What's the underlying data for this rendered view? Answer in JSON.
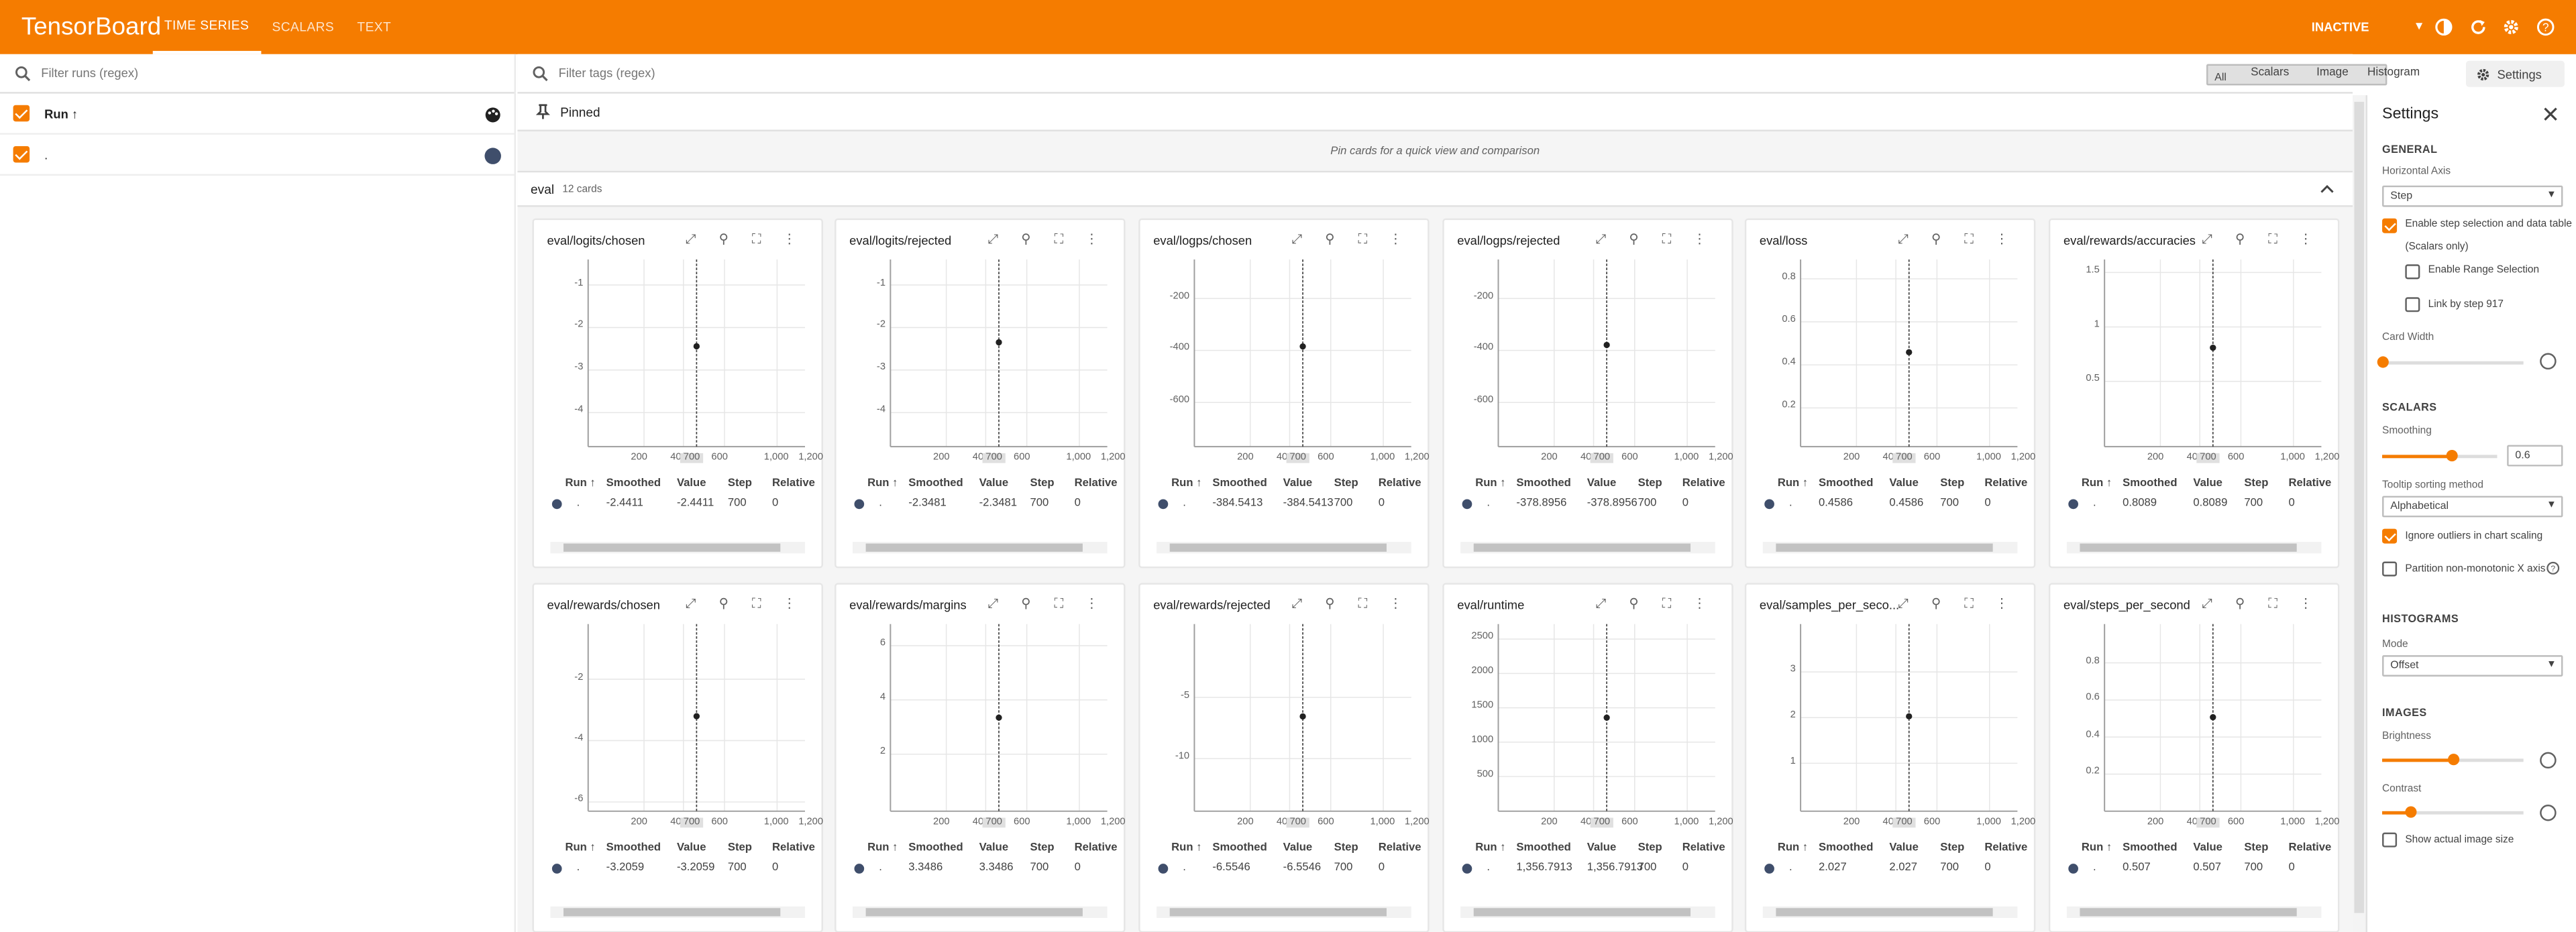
{
  "app": {
    "title": "TensorBoard",
    "tabs": [
      "TIME SERIES",
      "SCALARS",
      "TEXT"
    ],
    "status": "INACTIVE",
    "accent": "#f57c00"
  },
  "runs": {
    "filter_placeholder": "Filter runs (regex)",
    "header": "Run ↑",
    "items": [
      {
        "name": ".",
        "color": "#3f4e6b",
        "checked": true
      }
    ]
  },
  "toolbar": {
    "filter_placeholder": "Filter tags (regex)",
    "chips": [
      "All",
      "Scalars",
      "Image",
      "Histogram"
    ],
    "selected_chip": "All",
    "settings_label": "Settings"
  },
  "pinned": {
    "title": "Pinned",
    "message": "Pin cards for a quick view and comparison"
  },
  "group": {
    "name": "eval",
    "count": "12 cards"
  },
  "table_headers": [
    "Run ↑",
    "Smoothed",
    "Value",
    "Step",
    "Relative"
  ],
  "x_axis": {
    "ticks": [
      "200",
      "400",
      "600",
      "1,000",
      "1,200"
    ],
    "step_marker": "700"
  },
  "cards": [
    {
      "title": "eval/logits/chosen",
      "yticks": [
        "-1",
        "-2",
        "-3",
        "-4"
      ],
      "ylim": [
        -4.8,
        -0.4
      ],
      "value": -2.4411,
      "run": ".",
      "smoothed": "-2.4411",
      "value_text": "-2.4411",
      "step": "700",
      "relative": "0"
    },
    {
      "title": "eval/logits/rejected",
      "yticks": [
        "-1",
        "-2",
        "-3",
        "-4"
      ],
      "ylim": [
        -4.8,
        -0.4
      ],
      "value": -2.3481,
      "run": ".",
      "smoothed": "-2.3481",
      "value_text": "-2.3481",
      "step": "700",
      "relative": "0"
    },
    {
      "title": "eval/logps/chosen",
      "yticks": [
        "-200",
        "-400",
        "-600"
      ],
      "ylim": [
        -770,
        -50
      ],
      "value": -384.5413,
      "run": ".",
      "smoothed": "-384.5413",
      "value_text": "-384.5413",
      "step": "700",
      "relative": "0"
    },
    {
      "title": "eval/logps/rejected",
      "yticks": [
        "-200",
        "-400",
        "-600"
      ],
      "ylim": [
        -770,
        -50
      ],
      "value": -378.8956,
      "run": ".",
      "smoothed": "-378.8956",
      "value_text": "-378.8956",
      "step": "700",
      "relative": "0"
    },
    {
      "title": "eval/loss",
      "yticks": [
        "0.8",
        "0.6",
        "0.4",
        "0.2"
      ],
      "ylim": [
        0.02,
        0.89
      ],
      "value": 0.4586,
      "run": ".",
      "smoothed": "0.4586",
      "value_text": "0.4586",
      "step": "700",
      "relative": "0"
    },
    {
      "title": "eval/rewards/accuracies",
      "yticks": [
        "1.5",
        "1",
        "0.5"
      ],
      "ylim": [
        -0.1,
        1.62
      ],
      "value": 0.8089,
      "run": ".",
      "smoothed": "0.8089",
      "value_text": "0.8089",
      "step": "700",
      "relative": "0"
    },
    {
      "title": "eval/rewards/chosen",
      "yticks": [
        "-2",
        "-4",
        "-6"
      ],
      "ylim": [
        -6.3,
        -0.2
      ],
      "value": -3.2059,
      "run": ".",
      "smoothed": "-3.2059",
      "value_text": "-3.2059",
      "step": "700",
      "relative": "0"
    },
    {
      "title": "eval/rewards/margins",
      "yticks": [
        "6",
        "4",
        "2"
      ],
      "ylim": [
        -0.1,
        6.8
      ],
      "value": 3.3486,
      "run": ".",
      "smoothed": "3.3486",
      "value_text": "3.3486",
      "step": "700",
      "relative": "0"
    },
    {
      "title": "eval/rewards/rejected",
      "yticks": [
        "-5",
        "-10"
      ],
      "ylim": [
        -14.3,
        1.0
      ],
      "value": -6.5546,
      "run": ".",
      "smoothed": "-6.5546",
      "value_text": "-6.5546",
      "step": "700",
      "relative": "0"
    },
    {
      "title": "eval/runtime",
      "yticks": [
        "2500",
        "2000",
        "1500",
        "1000",
        "500"
      ],
      "ylim": [
        -5,
        2720
      ],
      "value": 1356.7913,
      "run": ".",
      "smoothed": "1,356.7913",
      "value_text": "1,356.7913",
      "step": "700",
      "relative": "0"
    },
    {
      "title": "eval/samples_per_seco...",
      "yticks": [
        "3",
        "2",
        "1"
      ],
      "ylim": [
        -0.05,
        4.05
      ],
      "value": 2.027,
      "run": ".",
      "smoothed": "2.027",
      "value_text": "2.027",
      "step": "700",
      "relative": "0"
    },
    {
      "title": "eval/steps_per_second",
      "yticks": [
        "0.8",
        "0.6",
        "0.4",
        "0.2"
      ],
      "ylim": [
        0.0,
        1.01
      ],
      "value": 0.507,
      "run": ".",
      "smoothed": "0.507",
      "value_text": "0.507",
      "step": "700",
      "relative": "0"
    }
  ],
  "settings": {
    "title": "Settings",
    "general": {
      "heading": "GENERAL",
      "horizontal_axis_label": "Horizontal Axis",
      "horizontal_axis_value": "Step",
      "step_selection_label": "Enable step selection and data table",
      "scalars_only": "(Scalars only)",
      "range_selection_label": "Enable Range Selection",
      "link_by_step_label": "Link by step 917",
      "card_width_label": "Card Width",
      "card_width_level": 0.0
    },
    "scalars": {
      "heading": "SCALARS",
      "smoothing_label": "Smoothing",
      "smoothing_value": "0.6",
      "smoothing_level": 0.6,
      "tooltip_label": "Tooltip sorting method",
      "tooltip_value": "Alphabetical",
      "ignore_outliers_label": "Ignore outliers in chart scaling",
      "partition_label": "Partition non-monotonic X axis"
    },
    "histograms": {
      "heading": "HISTOGRAMS",
      "mode_label": "Mode",
      "mode_value": "Offset"
    },
    "images": {
      "heading": "IMAGES",
      "brightness_label": "Brightness",
      "brightness_level": 0.5,
      "contrast_label": "Contrast",
      "contrast_level": 0.2,
      "actual_size_label": "Show actual image size"
    }
  }
}
